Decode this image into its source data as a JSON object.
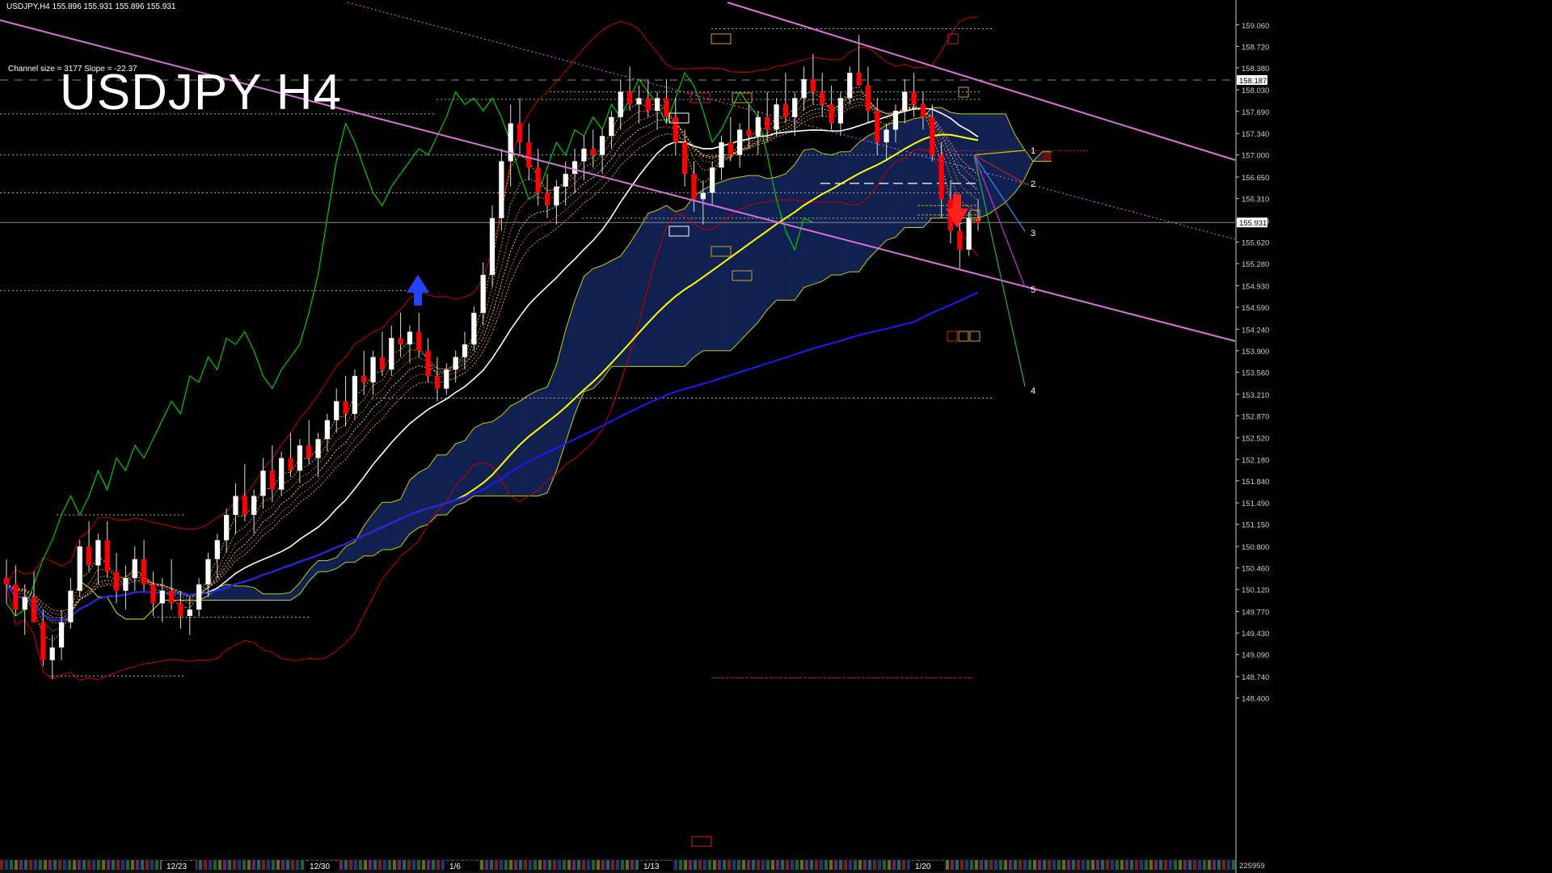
{
  "header": {
    "info_line": "USDJPY,H4  155.896 155.931 155.896 155.931",
    "channel_info": "Channel size = 3177 Slope = -22.37",
    "big_title": "USDJPY H4"
  },
  "colors": {
    "background": "#000000",
    "bull_candle": "#ffffff",
    "bear_candle": "#ff0000",
    "channel_line": "#e070e0",
    "sma_white": "#ffffff",
    "sma_yellow": "#ffff00",
    "sma_blue": "#1a1aff",
    "bollinger": "#cc0000",
    "chikou": "#00cc00",
    "cloud_bull": "#1e3c96",
    "cloud_bear": "#b41e1e",
    "kumo_edge": "#cccc00",
    "level_orange": "#d4a020",
    "level_red": "#cc2020",
    "current_price": "#888888"
  },
  "chart_data": {
    "type": "candlestick",
    "symbol": "USDJPY",
    "timeframe": "H4",
    "ylim": [
      148.42,
      159.3
    ],
    "y_ticks": [
      "159.060",
      "158.720",
      "158.380",
      "158.030",
      "157.690",
      "157.340",
      "157.000",
      "156.650",
      "156.310",
      "155.960",
      "155.620",
      "155.280",
      "154.930",
      "154.590",
      "154.240",
      "153.900",
      "153.560",
      "153.210",
      "152.870",
      "152.520",
      "152.180",
      "151.840",
      "151.490",
      "151.150",
      "150.800",
      "150.460",
      "150.120",
      "149.770",
      "149.430",
      "149.090",
      "148.740",
      "148.400"
    ],
    "x_ticks": [
      "12/23",
      "12/30",
      "1/6",
      "1/13",
      "1/20"
    ],
    "current_price": 155.931,
    "current_price_label": "155.931",
    "dashed_level": 158.187,
    "dashed_level_label": "158.187",
    "bottom_right_label": "225959",
    "candles": [
      [
        150.3,
        150.6,
        149.9,
        150.2
      ],
      [
        150.2,
        150.5,
        149.7,
        149.8
      ],
      [
        149.8,
        150.2,
        149.4,
        150.0
      ],
      [
        150.0,
        150.4,
        149.6,
        149.6
      ],
      [
        149.6,
        149.8,
        148.9,
        149.0
      ],
      [
        149.0,
        149.4,
        148.7,
        149.2
      ],
      [
        149.2,
        149.8,
        149.0,
        149.6
      ],
      [
        149.6,
        150.3,
        149.5,
        150.1
      ],
      [
        150.1,
        150.9,
        150.0,
        150.8
      ],
      [
        150.8,
        151.2,
        150.4,
        150.5
      ],
      [
        150.5,
        151.0,
        150.2,
        150.9
      ],
      [
        150.9,
        151.2,
        150.3,
        150.4
      ],
      [
        150.4,
        150.7,
        149.9,
        150.1
      ],
      [
        150.1,
        150.5,
        149.8,
        150.3
      ],
      [
        150.3,
        150.8,
        150.1,
        150.6
      ],
      [
        150.6,
        150.9,
        150.1,
        150.2
      ],
      [
        150.2,
        150.4,
        149.7,
        149.9
      ],
      [
        149.9,
        150.3,
        149.6,
        150.1
      ],
      [
        150.1,
        150.6,
        149.8,
        149.9
      ],
      [
        149.9,
        150.1,
        149.5,
        149.7
      ],
      [
        149.7,
        150.0,
        149.4,
        149.8
      ],
      [
        149.8,
        150.3,
        149.7,
        150.2
      ],
      [
        150.2,
        150.7,
        150.0,
        150.6
      ],
      [
        150.6,
        151.0,
        150.3,
        150.9
      ],
      [
        150.9,
        151.4,
        150.7,
        151.3
      ],
      [
        151.3,
        151.8,
        151.0,
        151.6
      ],
      [
        151.6,
        152.1,
        151.2,
        151.3
      ],
      [
        151.3,
        151.7,
        151.0,
        151.6
      ],
      [
        151.6,
        152.2,
        151.4,
        152.0
      ],
      [
        152.0,
        152.4,
        151.5,
        151.7
      ],
      [
        151.7,
        152.3,
        151.6,
        152.2
      ],
      [
        152.2,
        152.6,
        151.9,
        152.0
      ],
      [
        152.0,
        152.5,
        151.8,
        152.4
      ],
      [
        152.4,
        152.8,
        152.1,
        152.2
      ],
      [
        152.2,
        152.6,
        151.9,
        152.5
      ],
      [
        152.5,
        152.9,
        152.3,
        152.8
      ],
      [
        152.8,
        153.3,
        152.6,
        153.1
      ],
      [
        153.1,
        153.5,
        152.7,
        152.9
      ],
      [
        152.9,
        153.6,
        152.8,
        153.5
      ],
      [
        153.5,
        153.9,
        153.2,
        153.4
      ],
      [
        153.4,
        153.9,
        153.2,
        153.8
      ],
      [
        153.8,
        154.2,
        153.5,
        153.6
      ],
      [
        153.6,
        154.3,
        153.5,
        154.1
      ],
      [
        154.1,
        154.5,
        153.8,
        154.0
      ],
      [
        154.0,
        154.3,
        153.7,
        154.2
      ],
      [
        154.2,
        154.5,
        153.8,
        153.9
      ],
      [
        153.9,
        154.1,
        153.4,
        153.5
      ],
      [
        153.5,
        153.8,
        153.1,
        153.3
      ],
      [
        153.3,
        153.7,
        153.2,
        153.6
      ],
      [
        153.6,
        153.9,
        153.4,
        153.8
      ],
      [
        153.8,
        154.2,
        153.6,
        154.0
      ],
      [
        154.0,
        154.6,
        153.9,
        154.5
      ],
      [
        154.5,
        155.3,
        154.3,
        155.1
      ],
      [
        155.1,
        156.2,
        154.9,
        156.0
      ],
      [
        156.0,
        157.1,
        155.8,
        156.9
      ],
      [
        156.9,
        157.8,
        156.5,
        157.5
      ],
      [
        157.5,
        157.9,
        157.0,
        157.2
      ],
      [
        157.2,
        157.5,
        156.6,
        156.8
      ],
      [
        156.8,
        157.1,
        156.2,
        156.4
      ],
      [
        156.4,
        156.7,
        156.0,
        156.2
      ],
      [
        156.2,
        156.6,
        155.9,
        156.5
      ],
      [
        156.5,
        156.9,
        156.2,
        156.7
      ],
      [
        156.7,
        157.1,
        156.4,
        156.9
      ],
      [
        156.9,
        157.3,
        156.6,
        157.1
      ],
      [
        157.1,
        157.4,
        156.8,
        157.0
      ],
      [
        157.0,
        157.4,
        156.7,
        157.3
      ],
      [
        157.3,
        157.7,
        157.1,
        157.6
      ],
      [
        157.6,
        158.2,
        157.4,
        158.0
      ],
      [
        158.0,
        158.4,
        157.7,
        157.8
      ],
      [
        157.8,
        158.1,
        157.5,
        157.9
      ],
      [
        157.9,
        158.2,
        157.6,
        157.7
      ],
      [
        157.7,
        158.0,
        157.4,
        157.9
      ],
      [
        157.9,
        158.2,
        157.5,
        157.6
      ],
      [
        157.6,
        157.9,
        157.0,
        157.2
      ],
      [
        157.2,
        157.4,
        156.5,
        156.7
      ],
      [
        156.7,
        156.9,
        156.1,
        156.3
      ],
      [
        156.3,
        156.6,
        155.9,
        156.4
      ],
      [
        156.4,
        156.9,
        156.2,
        156.8
      ],
      [
        156.8,
        157.3,
        156.6,
        157.2
      ],
      [
        157.2,
        157.6,
        156.9,
        157.0
      ],
      [
        157.0,
        157.5,
        156.8,
        157.4
      ],
      [
        157.4,
        157.8,
        157.1,
        157.3
      ],
      [
        157.3,
        157.7,
        157.0,
        157.6
      ],
      [
        157.6,
        158.0,
        157.2,
        157.4
      ],
      [
        157.4,
        157.9,
        157.3,
        157.8
      ],
      [
        157.8,
        158.3,
        157.5,
        157.6
      ],
      [
        157.6,
        158.0,
        157.3,
        157.9
      ],
      [
        157.9,
        158.4,
        157.7,
        158.2
      ],
      [
        158.2,
        158.6,
        157.8,
        158.0
      ],
      [
        158.0,
        158.3,
        157.6,
        157.8
      ],
      [
        157.8,
        158.1,
        157.4,
        157.5
      ],
      [
        157.5,
        158.0,
        157.3,
        157.9
      ],
      [
        157.9,
        158.4,
        157.8,
        158.3
      ],
      [
        158.3,
        158.9,
        158.1,
        158.1
      ],
      [
        158.1,
        158.4,
        157.5,
        157.7
      ],
      [
        157.7,
        157.9,
        157.0,
        157.2
      ],
      [
        157.2,
        157.5,
        156.9,
        157.4
      ],
      [
        157.4,
        157.8,
        157.2,
        157.7
      ],
      [
        157.7,
        158.2,
        157.5,
        158.0
      ],
      [
        158.0,
        158.3,
        157.6,
        157.8
      ],
      [
        157.8,
        158.0,
        157.4,
        157.6
      ],
      [
        157.6,
        157.8,
        156.9,
        157.0
      ],
      [
        157.0,
        157.2,
        156.0,
        156.3
      ],
      [
        156.3,
        156.6,
        155.6,
        155.8
      ],
      [
        155.8,
        156.2,
        155.2,
        155.5
      ],
      [
        155.5,
        156.1,
        155.4,
        156.0
      ],
      [
        156.0,
        156.3,
        155.8,
        155.93
      ]
    ]
  }
}
